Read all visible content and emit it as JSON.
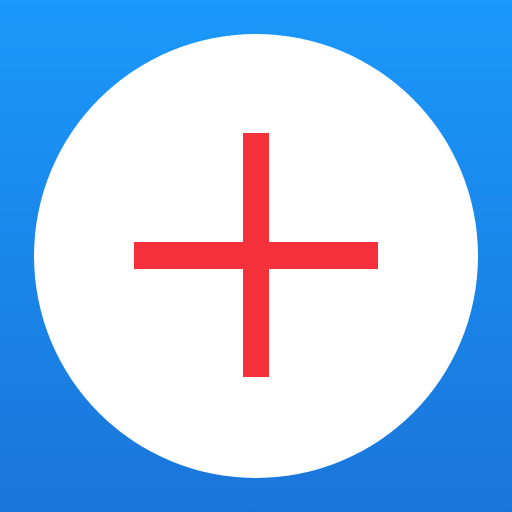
{
  "icon": {
    "name": "plus-icon",
    "colors": {
      "background_top": "#1a98fb",
      "background_bottom": "#1a75d9",
      "circle": "#ffffff",
      "plus": "#f4313a"
    }
  }
}
